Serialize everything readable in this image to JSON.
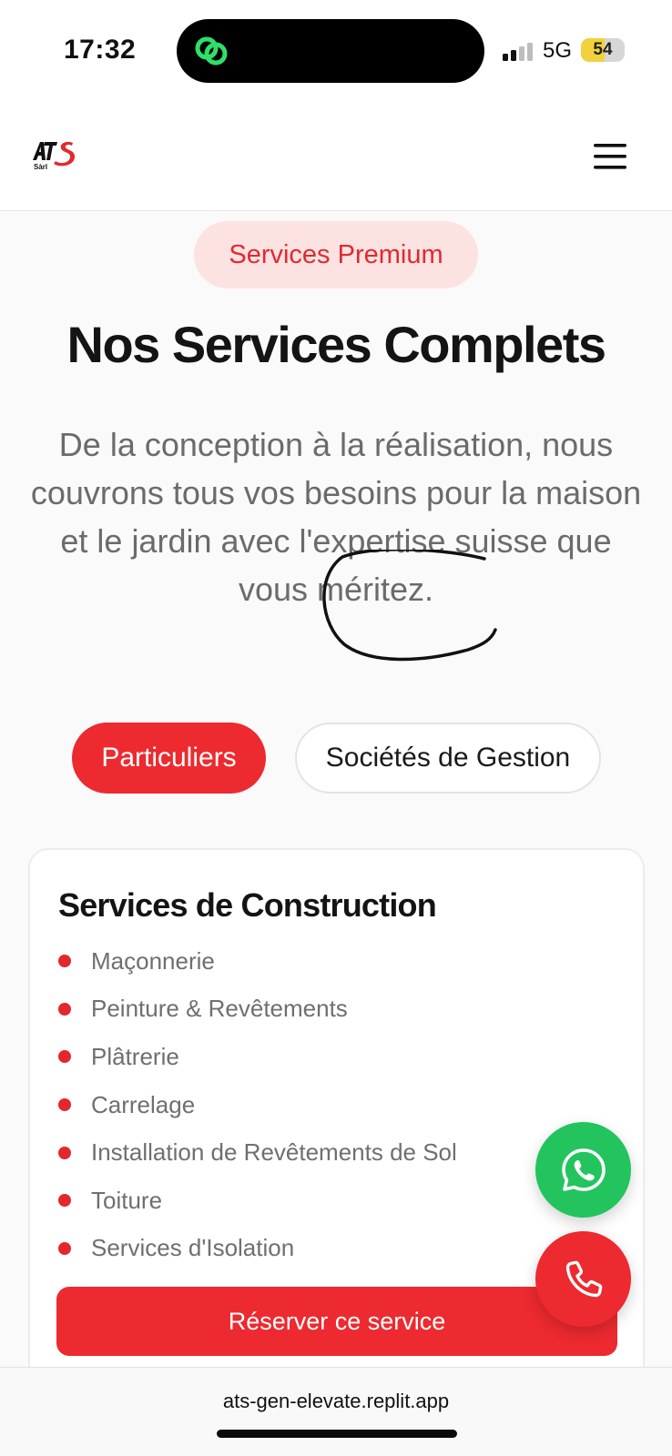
{
  "status_bar": {
    "time": "17:32",
    "network": "5G",
    "battery": "54",
    "battery_level_percent": 54
  },
  "header": {
    "logo_text": "ATS Sàrl",
    "menu_icon": "hamburger-menu-icon"
  },
  "hero": {
    "badge": "Services Premium",
    "title": "Nos Services Complets",
    "description": "De la conception à la réalisation, nous couvrons tous vos besoins pour la maison et le jardin avec l'expertise suisse que vous méritez."
  },
  "tabs": [
    {
      "label": "Particuliers",
      "active": true
    },
    {
      "label": "Sociétés de Gestion",
      "active": false
    }
  ],
  "card": {
    "title": "Services de Construction",
    "items": [
      "Maçonnerie",
      "Peinture & Revêtements",
      "Plâtrerie",
      "Carrelage",
      "Installation de Revêtements de Sol",
      "Toiture",
      "Services d'Isolation"
    ],
    "button": "Réserver ce service"
  },
  "fabs": {
    "whatsapp_icon": "whatsapp-icon",
    "phone_icon": "phone-icon"
  },
  "browser": {
    "url": "ats-gen-elevate.replit.app"
  },
  "colors": {
    "accent": "#ec2a2f",
    "badge_bg": "#fde2e2",
    "whatsapp": "#23c45e"
  }
}
